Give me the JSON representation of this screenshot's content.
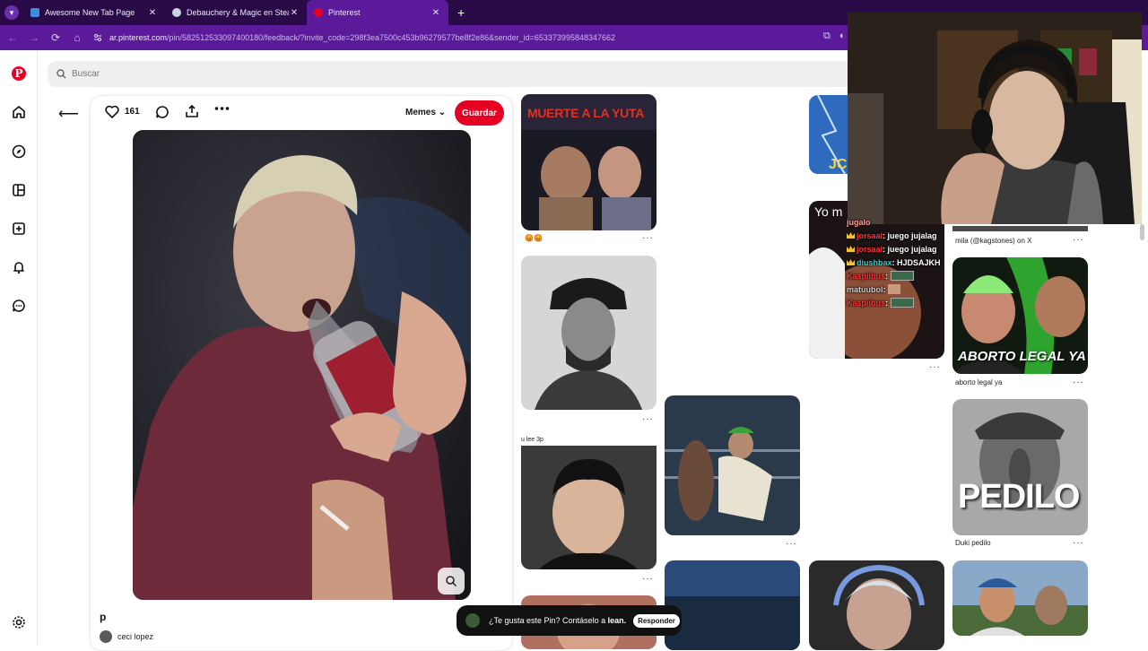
{
  "browser": {
    "tabs": [
      {
        "title": "Awesome New Tab Page",
        "favicon_color": "#3c8dde",
        "active": false
      },
      {
        "title": "Debauchery & Magic en Steam",
        "favicon_color": "#c7d5e0",
        "active": false
      },
      {
        "title": "Pinterest",
        "favicon_color": "#e60023",
        "active": true
      }
    ],
    "url_host": "ar.pinterest.com",
    "url_path": "/pin/582512533097400180/feedback/?invite_code=298f3ea7500c453b96279577be8f2e86&sender_id=653373995848347662",
    "theme_tab": "#2a0a46",
    "theme_bar": "#5a1a9a"
  },
  "search": {
    "placeholder": "Buscar"
  },
  "pin": {
    "likes": "161",
    "board": "Memes",
    "save_label": "Guardar",
    "title": "p",
    "author": "ceci lopez"
  },
  "grid": {
    "tile1": {
      "overlay": "MUERTE A LA YUTA",
      "meta": "😡😡"
    },
    "tile3_caption": "u lee 3p",
    "tile_yo": "Yo m",
    "tile_mila": "mila (@kagstones) on X",
    "tile_aborto": {
      "overlay": "ABORTO LEGAL YA",
      "meta": "aborto legal ya"
    },
    "tile_pedilo": {
      "overlay": "PEDILO",
      "meta": "Duki pedilo"
    }
  },
  "chat": [
    {
      "user": "",
      "text": "jugalo",
      "user_color": "#ff3333"
    },
    {
      "user": "jorsaal",
      "text": "juego jujalag",
      "user_color": "#ff3333"
    },
    {
      "user": "jorsaal",
      "text": "juego jujalag",
      "user_color": "#ff3333"
    },
    {
      "user": "diushbax",
      "text": "HJDSAJKH",
      "user_color": "#2ad0c8"
    },
    {
      "user": "Kaspiibus",
      "text": "",
      "user_color": "#ff3333"
    },
    {
      "user": "matuubol",
      "text": "",
      "user_color": "#cfcfcf"
    },
    {
      "user": "Kaspiibus",
      "text": "",
      "user_color": "#ff3333"
    }
  ],
  "toast": {
    "text": "¿Te gusta este Pin? Contáselo a ",
    "name": "lean.",
    "reply_label": "Responder"
  },
  "colors": {
    "pinterest_red": "#e60023"
  }
}
